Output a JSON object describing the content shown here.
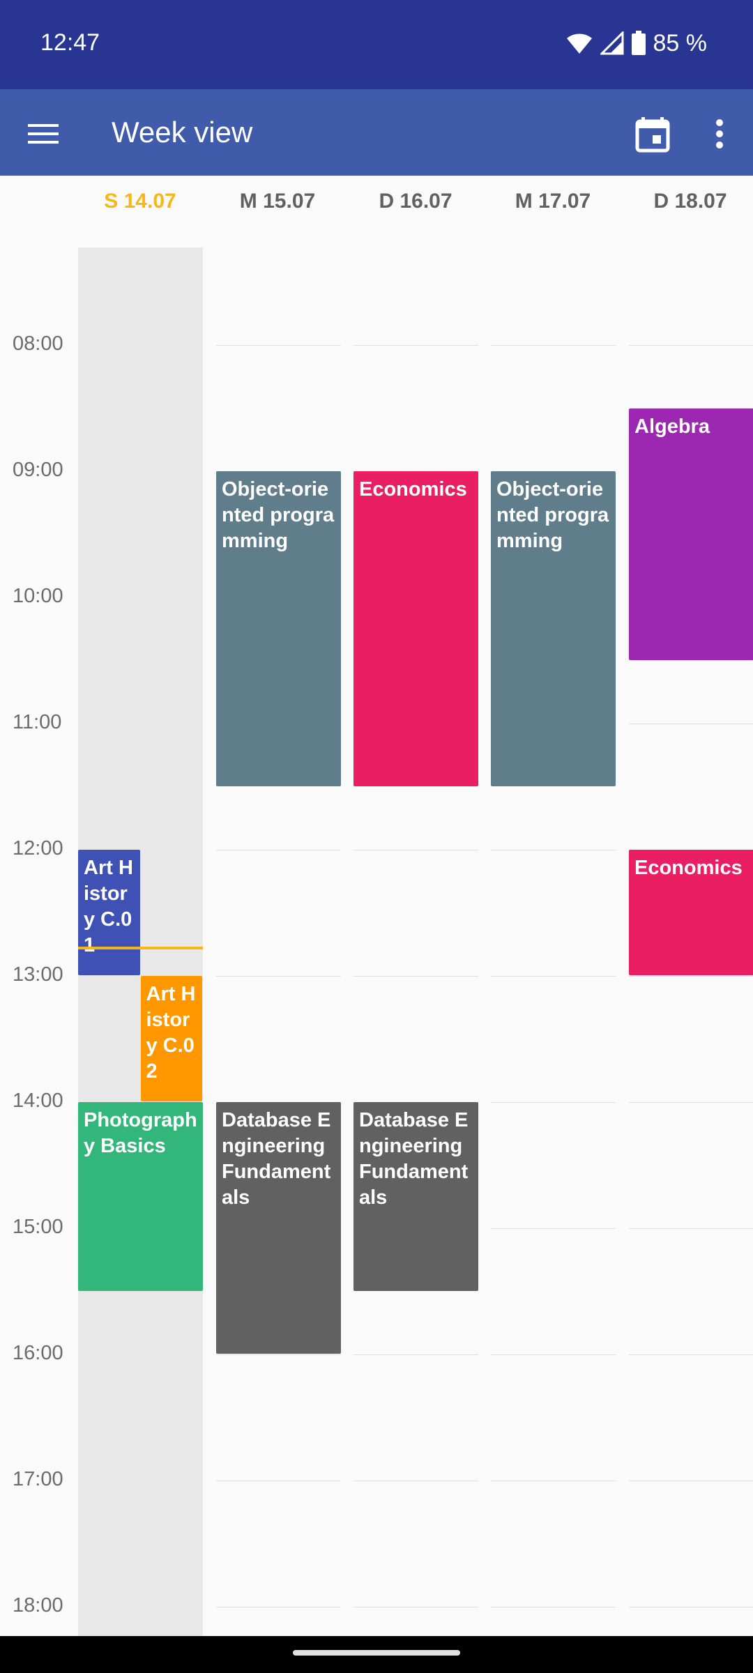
{
  "status_bar": {
    "time": "12:47",
    "battery": "85 %"
  },
  "app_bar": {
    "title": "Week view"
  },
  "days": [
    {
      "label": "S 14.07",
      "today": true
    },
    {
      "label": "M 15.07",
      "today": false
    },
    {
      "label": "D 16.07",
      "today": false
    },
    {
      "label": "M 17.07",
      "today": false
    },
    {
      "label": "D 18.07",
      "today": false
    }
  ],
  "hours": [
    "08:00",
    "09:00",
    "10:00",
    "11:00",
    "12:00",
    "13:00",
    "14:00",
    "15:00",
    "16:00",
    "17:00",
    "18:00"
  ],
  "events": [
    {
      "title": "Art History C.01",
      "day": 0,
      "start": 12.0,
      "end": 13.0,
      "color": "#3f51b5",
      "lane": 0,
      "lanes": 2
    },
    {
      "title": "Art History C.02",
      "day": 0,
      "start": 13.0,
      "end": 14.0,
      "color": "#ff9800",
      "lane": 1,
      "lanes": 2
    },
    {
      "title": "Photography Basics",
      "day": 0,
      "start": 14.0,
      "end": 15.5,
      "color": "#33b679",
      "lane": 0,
      "lanes": 1
    },
    {
      "title": "Object-oriented programming",
      "day": 1,
      "start": 9.0,
      "end": 11.5,
      "color": "#607d8b",
      "lane": 0,
      "lanes": 1
    },
    {
      "title": "Database Engineering Fundamentals",
      "day": 1,
      "start": 14.0,
      "end": 16.0,
      "color": "#616161",
      "lane": 0,
      "lanes": 1
    },
    {
      "title": "Economics",
      "day": 2,
      "start": 9.0,
      "end": 11.5,
      "color": "#e91e63",
      "lane": 0,
      "lanes": 1
    },
    {
      "title": "Database Engineering Fundamentals",
      "day": 2,
      "start": 14.0,
      "end": 15.5,
      "color": "#616161",
      "lane": 0,
      "lanes": 1
    },
    {
      "title": "Object-oriented programming",
      "day": 3,
      "start": 9.0,
      "end": 11.5,
      "color": "#607d8b",
      "lane": 0,
      "lanes": 1
    },
    {
      "title": "Algebra",
      "day": 4,
      "start": 8.5,
      "end": 10.5,
      "color": "#9c27b0",
      "lane": 0,
      "lanes": 1
    },
    {
      "title": "Economics",
      "day": 4,
      "start": 12.0,
      "end": 13.0,
      "color": "#e91e63",
      "lane": 0,
      "lanes": 1
    }
  ],
  "now_time": 12.77,
  "colors": {
    "status_bar": "#283593",
    "app_bar": "#3f5ba9",
    "today_accent": "#f6b817",
    "background": "#fafafa",
    "today_column": "#e8e8e8"
  },
  "icons": {
    "menu": "menu-icon",
    "calendar": "calendar-today-icon",
    "more": "more-vert-icon",
    "wifi": "wifi-icon",
    "signal": "signal-icon",
    "battery": "battery-icon"
  }
}
